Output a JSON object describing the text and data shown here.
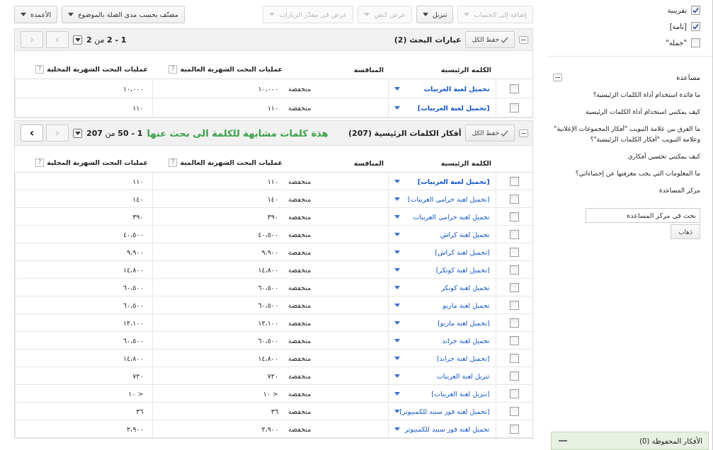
{
  "toolbar": {
    "actions": [
      {
        "label": "إضافة إلى الحساب",
        "disabled": true
      },
      {
        "label": "تنزيل",
        "disabled": false
      },
      {
        "label": "عرض كنص",
        "disabled": true
      },
      {
        "label": "عرض في مقدّر الزيارات",
        "disabled": true
      }
    ],
    "view": [
      {
        "label": "مصنّف بحسب مدى الصلة بالموضوع",
        "disabled": false
      },
      {
        "label": "الأعمدة",
        "disabled": false
      }
    ]
  },
  "sections": [
    {
      "title": "عبارات البحث (2)",
      "save": "حفظ الكل",
      "range": "**1 - 2** من **2**",
      "pager": [
        {
          "label": "›",
          "disabled": true
        },
        {
          "label": "‹",
          "disabled": true
        }
      ],
      "columns": [
        {
          "label": "الكلمة الرئيسية"
        },
        {
          "label": "المنافسة"
        },
        {
          "label": "عمليات البحث الشهرية العالمية",
          "help": "?"
        },
        {
          "label": "عمليات البحث الشهرية المحلية",
          "help": "?"
        }
      ],
      "rows": [
        {
          "checked": false,
          "keyword": "تحميل لعبة العربيات",
          "bold": true,
          "competition": "منخفضة",
          "global": "١٠،٠٠٠",
          "local": "١٠،٠٠٠"
        },
        {
          "checked": false,
          "keyword": "[تحميل لعبة العربيات]",
          "bold": true,
          "competition": "منخفضة",
          "global": "١١٠",
          "local": "١١٠"
        }
      ]
    },
    {
      "title": "أفكار الكلمات الرئيسية (207)",
      "save": "حفظ الكل",
      "note": "هذة كلمات مشابهة للكلمة الى بحث عنها",
      "range": "**1 - 50** من **207**",
      "pager": [
        {
          "label": "‹",
          "disabled": true
        },
        {
          "label": "›",
          "disabled": false
        }
      ],
      "columns": [
        {
          "label": "الكلمة الرئيسية"
        },
        {
          "label": "المنافسة"
        },
        {
          "label": "عمليات البحث الشهرية العالمية",
          "help": "?"
        },
        {
          "label": "عمليات البحث الشهرية المحلية",
          "help": "?"
        }
      ],
      "rows": [
        {
          "checked": false,
          "keyword": "[تحميل لعبة العربيات]",
          "bold": true,
          "competition": "منخفضة",
          "global": "١١٠",
          "local": "١١٠"
        },
        {
          "checked": false,
          "keyword": "[تحميل لعبة حرامى العربيات]",
          "bold": false,
          "competition": "منخفضة",
          "global": "١٤٠",
          "local": "١٤٠"
        },
        {
          "checked": false,
          "keyword": "تحميل لعبة حرامى العربيات",
          "bold": false,
          "competition": "منخفضة",
          "global": "٣٩٠",
          "local": "٣٩٠"
        },
        {
          "checked": false,
          "keyword": "تحميل لعبة كراش",
          "bold": false,
          "competition": "منخفضة",
          "global": "٤٠،٥٠٠",
          "local": "٤٠،٥٠٠"
        },
        {
          "checked": false,
          "keyword": "[تحميل لعبة كراش]",
          "bold": false,
          "competition": "منخفضة",
          "global": "٩،٩٠٠",
          "local": "٩،٩٠٠"
        },
        {
          "checked": false,
          "keyword": "[تحميل لعبة كونكر]",
          "bold": false,
          "competition": "منخفضة",
          "global": "١٤،٨٠٠",
          "local": "١٤،٨٠٠"
        },
        {
          "checked": false,
          "keyword": "تحميل لعبة كونكر",
          "bold": false,
          "competition": "منخفضة",
          "global": "٦٠،٥٠٠",
          "local": "٦٠،٥٠٠"
        },
        {
          "checked": false,
          "keyword": "تحميل لعبة ماريو",
          "bold": false,
          "competition": "منخفضة",
          "global": "٦٠،٥٠٠",
          "local": "٦٠،٥٠٠"
        },
        {
          "checked": false,
          "keyword": "[تحميل لعبة ماريو]",
          "bold": false,
          "competition": "منخفضة",
          "global": "١٢،١٠٠",
          "local": "١٢،١٠٠"
        },
        {
          "checked": false,
          "keyword": "تحميل لعبة جراند",
          "bold": false,
          "competition": "منخفضة",
          "global": "٦٠،٥٠٠",
          "local": "٦٠،٥٠٠"
        },
        {
          "checked": false,
          "keyword": "[تحميل لعبة جراند]",
          "bold": false,
          "competition": "منخفضة",
          "global": "١٤،٨٠٠",
          "local": "١٤،٨٠٠"
        },
        {
          "checked": false,
          "keyword": "تنزيل لعبة العربيات",
          "bold": false,
          "competition": "منخفضة",
          "global": "٧٢٠",
          "local": "٧٢٠"
        },
        {
          "checked": false,
          "keyword": "[تنزيل لعبة العربيات]",
          "bold": false,
          "competition": "منخفضة",
          "global": "< ١٠",
          "local": "< ١٠"
        },
        {
          "checked": false,
          "keyword": "[تحميل لعبة فور سبيد للكمبيوتر]",
          "bold": false,
          "competition": "منخفضة",
          "global": "٣٦",
          "local": "٣٦"
        },
        {
          "checked": false,
          "keyword": "تحميل لعبة فور سبيد للكمبيوتر",
          "bold": false,
          "competition": "منخفضة",
          "global": "٢،٩٠٠",
          "local": "٢،٩٠٠"
        }
      ]
    }
  ],
  "sidebar": {
    "match_types": [
      {
        "label": "تقريبية",
        "checked": true
      },
      {
        "label": "[تامة]",
        "checked": true
      },
      {
        "label": "\"جملة\"",
        "checked": false
      }
    ],
    "help": {
      "title": "مساعدة",
      "links": [
        "ما فائدة استخدام أداة الكلمات الرئيسية؟",
        "كيف يمكنني استخدام أداة الكلمات الرئيسية",
        "ما الفرق بين علامة التبويب \"أفكار المجموعات الإعلانية\" وعلامة التبويب \"أفكار الكلمات الرئيسية\"؟",
        "كيف يمكنني تحسين أفكاري",
        "ما المعلومات التي يجب معرفتها عن إحصاءاتي؟",
        "مركز المساعدة"
      ],
      "search": {
        "placeholder": "بحث في مركز المساعدة"
      },
      "button": "ذهاب"
    },
    "saved": {
      "title": "الأفكار المحفوظة (0)"
    }
  }
}
